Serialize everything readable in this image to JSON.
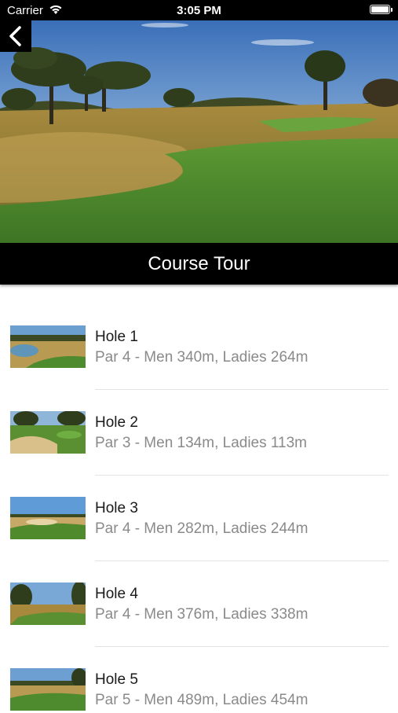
{
  "status_bar": {
    "carrier": "Carrier",
    "time": "3:05 PM",
    "icons": [
      "wifi-icon",
      "battery-icon"
    ]
  },
  "header": {
    "back_icon": "chevron-left-icon",
    "title": "Course Tour"
  },
  "holes": [
    {
      "title": "Hole 1",
      "subtitle": "Par 4 - Men 340m, Ladies 264m"
    },
    {
      "title": "Hole 2",
      "subtitle": "Par 3 - Men 134m, Ladies 113m"
    },
    {
      "title": "Hole 3",
      "subtitle": "Par 4 - Men 282m, Ladies 244m"
    },
    {
      "title": "Hole 4",
      "subtitle": "Par 4 - Men 376m, Ladies 338m"
    },
    {
      "title": "Hole 5",
      "subtitle": "Par 5 - Men 489m, Ladies 454m"
    }
  ],
  "colors": {
    "bar_background": "#000000",
    "subtitle_gray": "#8a8a8a",
    "fairway_green": "#4f8a2c"
  }
}
